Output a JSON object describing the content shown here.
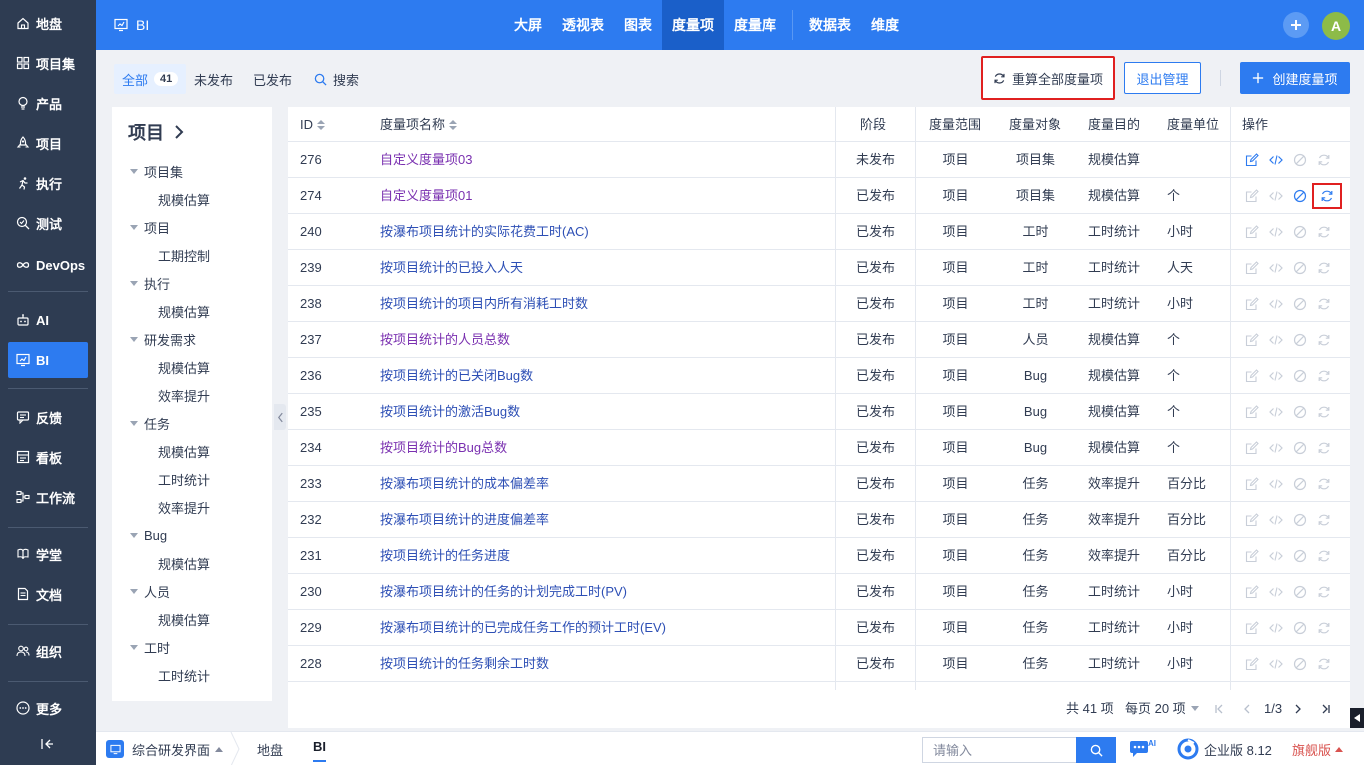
{
  "sidebar": {
    "items": [
      {
        "label": "地盘",
        "icon": "home-icon"
      },
      {
        "label": "项目集",
        "icon": "grid-icon"
      },
      {
        "label": "产品",
        "icon": "bulb-icon"
      },
      {
        "label": "项目",
        "icon": "rocket-icon"
      },
      {
        "label": "执行",
        "icon": "run-icon"
      },
      {
        "label": "测试",
        "icon": "search-check-icon"
      },
      {
        "label": "DevOps",
        "icon": "infinity-icon"
      },
      {
        "label": "AI",
        "icon": "robot-icon"
      },
      {
        "label": "BI",
        "icon": "monitor-chart-icon"
      },
      {
        "label": "反馈",
        "icon": "feedback-icon"
      },
      {
        "label": "看板",
        "icon": "board-icon"
      },
      {
        "label": "工作流",
        "icon": "workflow-icon"
      },
      {
        "label": "学堂",
        "icon": "school-icon"
      },
      {
        "label": "文档",
        "icon": "doc-icon"
      },
      {
        "label": "组织",
        "icon": "people-icon"
      },
      {
        "label": "更多",
        "icon": "more-icon"
      }
    ]
  },
  "topbar": {
    "app_name": "BI",
    "nav": [
      "大屏",
      "透视表",
      "图表",
      "度量项",
      "度量库",
      "数据表",
      "维度"
    ],
    "avatar": "A"
  },
  "subbar": {
    "tabs": {
      "all": "全部",
      "all_count": "41",
      "unpublished": "未发布",
      "published": "已发布",
      "search": "搜索"
    },
    "recalc_all": "重算全部度量项",
    "exit_manage": "退出管理",
    "create": "创建度量项"
  },
  "tree": {
    "title": "项目",
    "nodes": [
      {
        "label": "项目集",
        "level": 0
      },
      {
        "label": "规模估算",
        "level": 1
      },
      {
        "label": "项目",
        "level": 0
      },
      {
        "label": "工期控制",
        "level": 1
      },
      {
        "label": "执行",
        "level": 0
      },
      {
        "label": "规模估算",
        "level": 1
      },
      {
        "label": "研发需求",
        "level": 0
      },
      {
        "label": "规模估算",
        "level": 1
      },
      {
        "label": "效率提升",
        "level": 1
      },
      {
        "label": "任务",
        "level": 0
      },
      {
        "label": "规模估算",
        "level": 1
      },
      {
        "label": "工时统计",
        "level": 1
      },
      {
        "label": "效率提升",
        "level": 1
      },
      {
        "label": "Bug",
        "level": 0
      },
      {
        "label": "规模估算",
        "level": 1
      },
      {
        "label": "人员",
        "level": 0
      },
      {
        "label": "规模估算",
        "level": 1
      },
      {
        "label": "工时",
        "level": 0
      },
      {
        "label": "工时统计",
        "level": 1
      }
    ]
  },
  "table": {
    "headers": {
      "id": "ID",
      "name": "度量项名称",
      "stage": "阶段",
      "scope": "度量范围",
      "object": "度量对象",
      "purpose": "度量目的",
      "unit": "度量单位",
      "ops": "操作"
    },
    "rows": [
      {
        "id": "276",
        "name": "自定义度量项03",
        "stage": "未发布",
        "scope": "项目",
        "object": "项目集",
        "purpose": "规模估算",
        "unit": "",
        "visited": true
      },
      {
        "id": "274",
        "name": "自定义度量项01",
        "stage": "已发布",
        "scope": "项目",
        "object": "项目集",
        "purpose": "规模估算",
        "unit": "个",
        "visited": true
      },
      {
        "id": "240",
        "name": "按瀑布项目统计的实际花费工时(AC)",
        "stage": "已发布",
        "scope": "项目",
        "object": "工时",
        "purpose": "工时统计",
        "unit": "小时",
        "visited": false
      },
      {
        "id": "239",
        "name": "按项目统计的已投入人天",
        "stage": "已发布",
        "scope": "项目",
        "object": "工时",
        "purpose": "工时统计",
        "unit": "人天",
        "visited": false
      },
      {
        "id": "238",
        "name": "按项目统计的项目内所有消耗工时数",
        "stage": "已发布",
        "scope": "项目",
        "object": "工时",
        "purpose": "工时统计",
        "unit": "小时",
        "visited": false
      },
      {
        "id": "237",
        "name": "按项目统计的人员总数",
        "stage": "已发布",
        "scope": "项目",
        "object": "人员",
        "purpose": "规模估算",
        "unit": "个",
        "visited": true
      },
      {
        "id": "236",
        "name": "按项目统计的已关闭Bug数",
        "stage": "已发布",
        "scope": "项目",
        "object": "Bug",
        "purpose": "规模估算",
        "unit": "个",
        "visited": false
      },
      {
        "id": "235",
        "name": "按项目统计的激活Bug数",
        "stage": "已发布",
        "scope": "项目",
        "object": "Bug",
        "purpose": "规模估算",
        "unit": "个",
        "visited": false
      },
      {
        "id": "234",
        "name": "按项目统计的Bug总数",
        "stage": "已发布",
        "scope": "项目",
        "object": "Bug",
        "purpose": "规模估算",
        "unit": "个",
        "visited": true
      },
      {
        "id": "233",
        "name": "按瀑布项目统计的成本偏差率",
        "stage": "已发布",
        "scope": "项目",
        "object": "任务",
        "purpose": "效率提升",
        "unit": "百分比",
        "visited": false
      },
      {
        "id": "232",
        "name": "按瀑布项目统计的进度偏差率",
        "stage": "已发布",
        "scope": "项目",
        "object": "任务",
        "purpose": "效率提升",
        "unit": "百分比",
        "visited": false
      },
      {
        "id": "231",
        "name": "按项目统计的任务进度",
        "stage": "已发布",
        "scope": "项目",
        "object": "任务",
        "purpose": "效率提升",
        "unit": "百分比",
        "visited": false
      },
      {
        "id": "230",
        "name": "按瀑布项目统计的任务的计划完成工时(PV)",
        "stage": "已发布",
        "scope": "项目",
        "object": "任务",
        "purpose": "工时统计",
        "unit": "小时",
        "visited": false
      },
      {
        "id": "229",
        "name": "按瀑布项目统计的已完成任务工作的预计工时(EV)",
        "stage": "已发布",
        "scope": "项目",
        "object": "任务",
        "purpose": "工时统计",
        "unit": "小时",
        "visited": false
      },
      {
        "id": "228",
        "name": "按项目统计的任务剩余工时数",
        "stage": "已发布",
        "scope": "项目",
        "object": "任务",
        "purpose": "工时统计",
        "unit": "小时",
        "visited": false
      }
    ]
  },
  "pager": {
    "total": "共 41 项",
    "per_page": "每页 20 项",
    "page": "1/3"
  },
  "taskbar": {
    "workspace": "综合研发界面",
    "crumb1": "地盘",
    "crumb2": "BI",
    "search_placeholder": "请输入",
    "edition": "企业版 8.12",
    "flagship": "旗舰版"
  },
  "colors": {
    "primary": "#2d7bf0",
    "sidebar": "#2e3c52",
    "highlight": "#e02020",
    "link": "#2d4fb5",
    "visited": "#7a30b0"
  }
}
